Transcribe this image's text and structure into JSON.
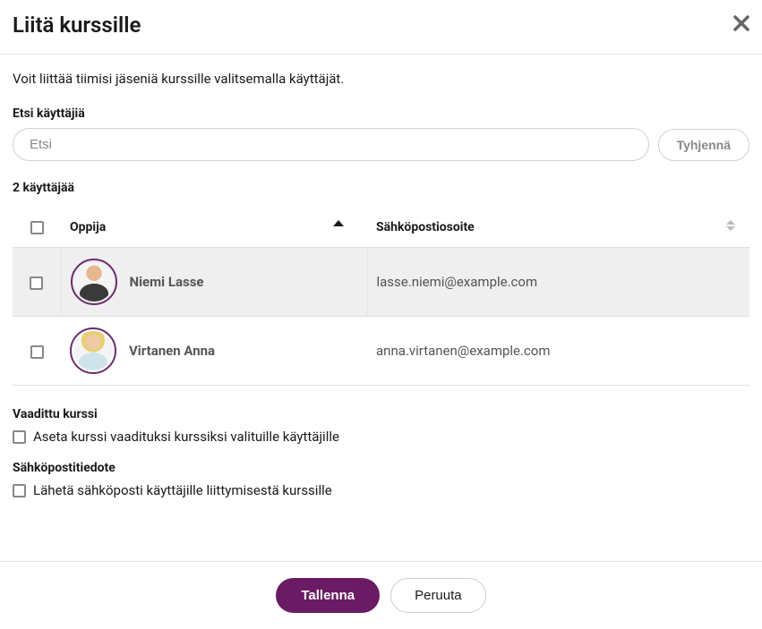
{
  "modal": {
    "title": "Liitä kurssille",
    "intro": "Voit liittää tiimisi jäseniä kurssille valitsemalla käyttäjät."
  },
  "search": {
    "label": "Etsi käyttäjiä",
    "placeholder": "Etsi",
    "clear_label": "Tyhjennä"
  },
  "results": {
    "count_text": "2 käyttäjää",
    "columns": {
      "learner": "Oppija",
      "email": "Sähköpostiosoite"
    },
    "rows": [
      {
        "name": "Niemi Lasse",
        "email": "lasse.niemi@example.com",
        "avatar": "m"
      },
      {
        "name": "Virtanen Anna",
        "email": "anna.virtanen@example.com",
        "avatar": "f"
      }
    ]
  },
  "required_section": {
    "heading": "Vaadittu kurssi",
    "checkbox_label": "Aseta kurssi vaadituksi kurssiksi valituille käyttäjille"
  },
  "email_section": {
    "heading": "Sähköpostitiedote",
    "checkbox_label": "Lähetä sähköposti käyttäjille liittymisestä kurssille"
  },
  "footer": {
    "save": "Tallenna",
    "cancel": "Peruuta"
  }
}
